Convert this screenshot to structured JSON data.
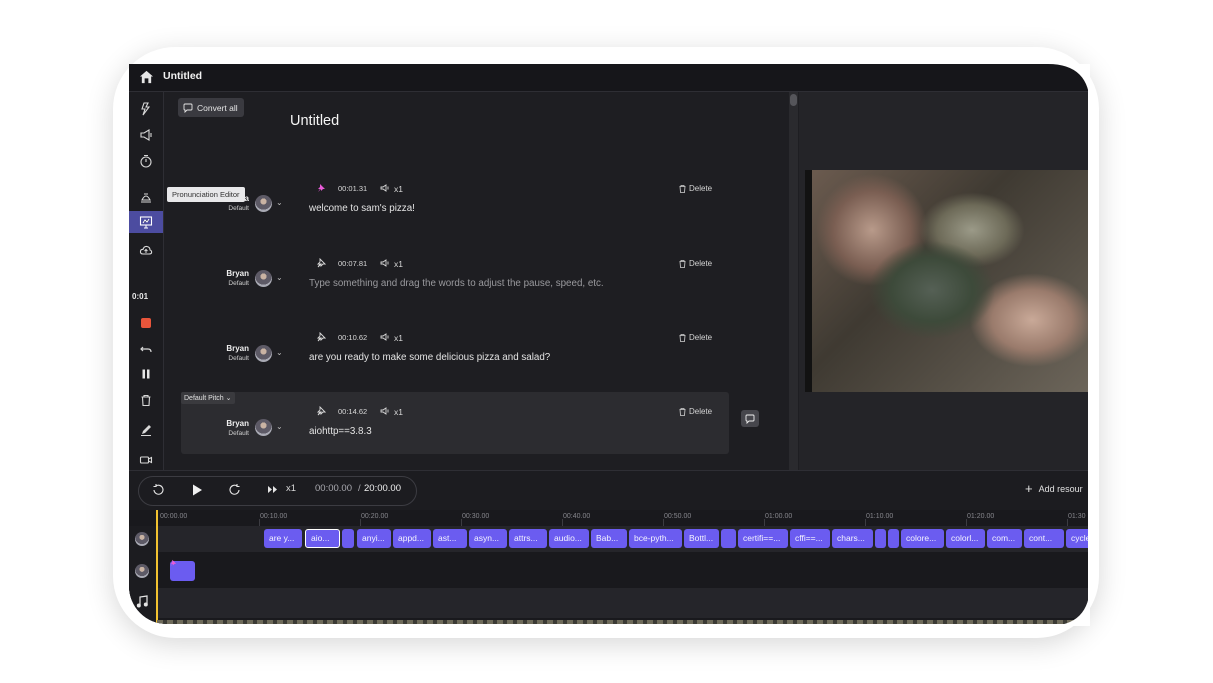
{
  "window": {
    "title": "Untitled"
  },
  "sidebar": {
    "timecode": "0:01",
    "tooltip": "Pronunciation Editor",
    "icons": [
      "magic-icon",
      "megaphone-icon",
      "timer-icon",
      "pronunciation-icon",
      "presentation-icon",
      "cloud-upload-icon",
      "record-icon",
      "undo-icon",
      "pause-icon",
      "trash-icon",
      "pen-icon",
      "camera-icon"
    ]
  },
  "editor": {
    "convert_all_label": "Convert all",
    "doc_title": "Untitled",
    "pitch_label": "Default Pitch",
    "rows": [
      {
        "speaker": "Joanna",
        "style": "Default",
        "time": "00:01.31",
        "speed": "x1",
        "text": "welcome to sam's pizza!",
        "delete": "Delete",
        "placeholder": false
      },
      {
        "speaker": "Bryan",
        "style": "Default",
        "time": "00:07.81",
        "speed": "x1",
        "text": "Type something and drag the words to adjust the pause, speed, etc.",
        "delete": "Delete",
        "placeholder": true
      },
      {
        "speaker": "Bryan",
        "style": "Default",
        "time": "00:10.62",
        "speed": "x1",
        "text": "are you ready to make some delicious pizza and salad?",
        "delete": "Delete",
        "placeholder": false
      },
      {
        "speaker": "Bryan",
        "style": "Default",
        "time": "00:14.62",
        "speed": "x1",
        "text": "aiohttp==3.8.3",
        "delete": "Delete",
        "placeholder": false
      }
    ]
  },
  "player": {
    "speed": "x1",
    "current_time": "00:00.00",
    "separator": "/",
    "total_time": "20:00.00",
    "add_resource_label": "Add resour"
  },
  "timeline": {
    "ruler": [
      "00:00.00",
      "00:10.00",
      "00:20.00",
      "00:30.00",
      "00:40.00",
      "00:50.00",
      "01:00.00",
      "01:10.00",
      "01:20.00",
      "01:30"
    ],
    "clips": [
      "are y...",
      "aio...",
      "",
      "anyi...",
      "appd...",
      "ast...",
      "asyn...",
      "attrs...",
      "audio...",
      "Bab...",
      "bce-pyth...",
      "Bottl...",
      "",
      "certifi==...",
      "cffi==...",
      "chars...",
      "",
      "",
      "colore...",
      "colorl...",
      "com...",
      "cont...",
      "cycle"
    ],
    "selected_clip_index": 1
  },
  "colors": {
    "accent": "#6b5cf0",
    "record": "#e8553b",
    "playhead": "#f2c230",
    "background": "#1e1e22"
  }
}
